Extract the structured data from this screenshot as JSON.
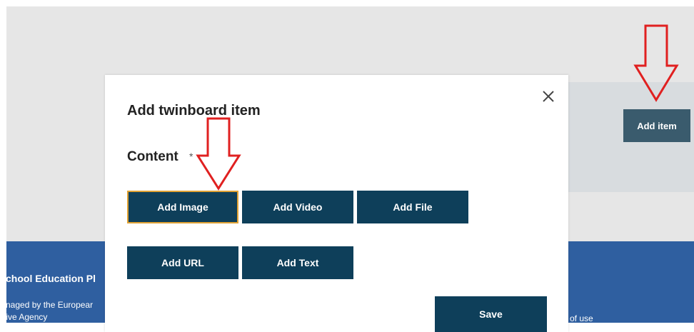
{
  "page": {
    "add_item_label": "Add item"
  },
  "footer": {
    "title": "chool Education Pl",
    "line1": "naged by the Europear",
    "line2": "tive Agency",
    "terms": "of use"
  },
  "modal": {
    "title": "Add twinboard item",
    "close_icon": "close-icon",
    "content_label": "Content",
    "required_mark": "*",
    "buttons": {
      "add_image": "Add Image",
      "add_video": "Add Video",
      "add_file": "Add File",
      "add_url": "Add URL",
      "add_text": "Add Text"
    },
    "save_label": "Save"
  },
  "annotations": {
    "arrow_color": "#e02020",
    "arrow_icon": "down-arrow-annotation-icon"
  },
  "colors": {
    "button_dark": "#0e3f5a",
    "add_item_button": "#3a5b6d",
    "focus_outline": "#e0a234",
    "footer_blue": "#2f5fa0"
  }
}
